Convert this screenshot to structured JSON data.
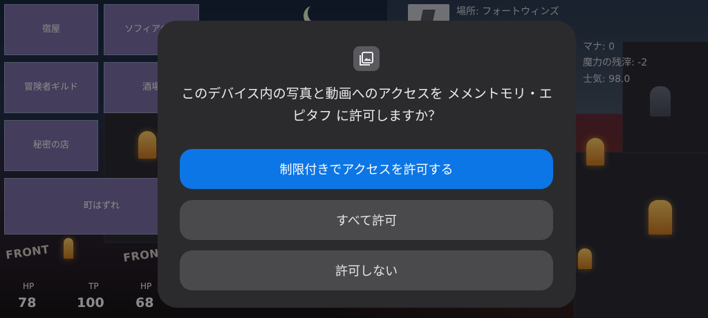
{
  "menu": {
    "inn": "宿屋",
    "sofia_shop": "ソフィアの店",
    "adventurers_guild": "冒険者ギルド",
    "tavern": "酒場",
    "secret_shop": "秘密の店",
    "town_outskirts": "町はずれ"
  },
  "hud": {
    "location": "場所: フォートウィンズ",
    "mana": "マナ: 0",
    "magic_residue": "魔力の残滓: -2",
    "morale": "士気: 98.0"
  },
  "party": {
    "front_label": "FRONT",
    "members": [
      {
        "label": "HP",
        "value": "78"
      },
      {
        "label": "TP",
        "value": "100"
      },
      {
        "label": "HP",
        "value": "68"
      }
    ]
  },
  "dialog": {
    "icon": "photo-library-icon",
    "message": "このデバイス内の写真と動画へのアクセスを メメントモリ・エピタフ に許可しますか？",
    "allow_limited": "制限付きでアクセスを許可する",
    "allow_all": "すべて許可",
    "deny": "許可しない"
  },
  "colors": {
    "menu_button": "#7c6fa6",
    "dialog_bg": "#2b2b2d",
    "primary_button": "#0d76e6",
    "secondary_button": "#4a4a4c"
  }
}
